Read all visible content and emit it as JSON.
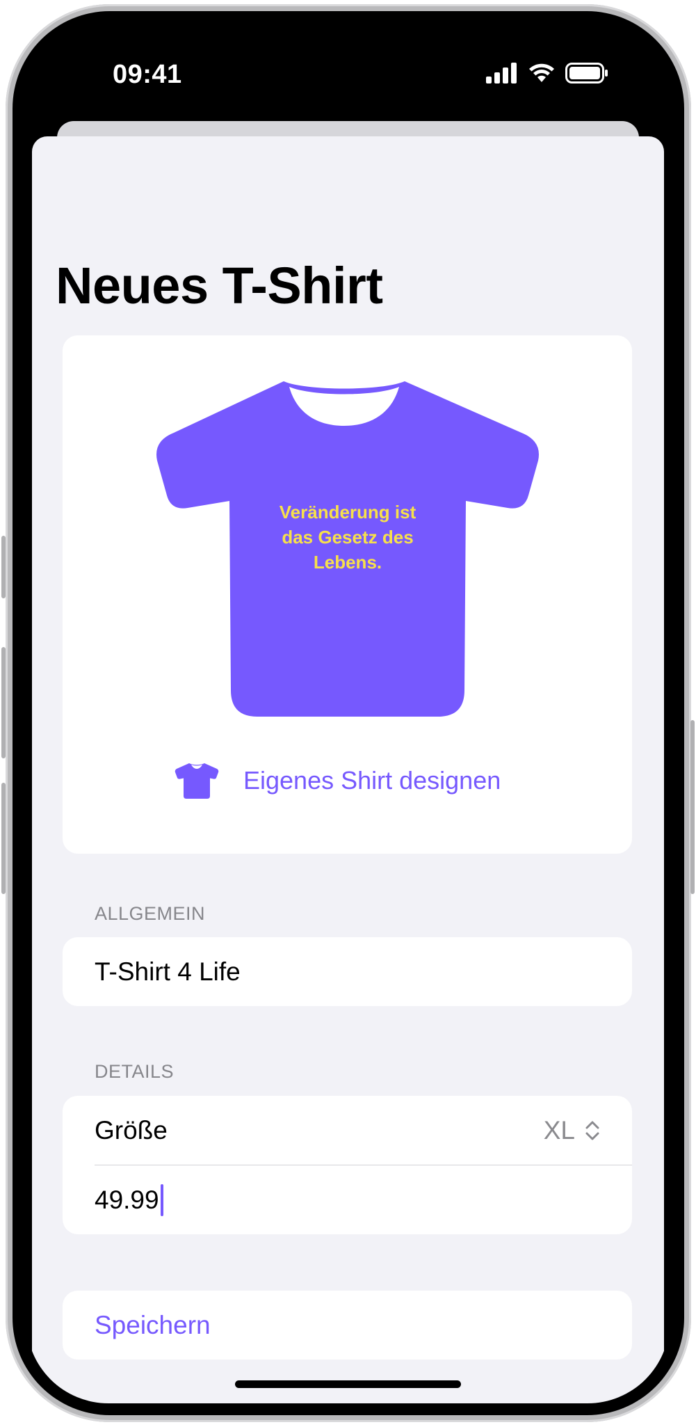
{
  "status_bar": {
    "time": "09:41"
  },
  "sheet": {
    "title": "Neues T-Shirt"
  },
  "shirt_preview": {
    "shirt_color": "#7659FE",
    "text_color": "#F7E04B",
    "shirt_text": "Veränderung ist\ndas Gesetz des\nLebens.",
    "design_button_label": "Eigenes Shirt designen",
    "design_button_icon": "tshirt-icon"
  },
  "sections": {
    "general": {
      "header": "ALLGEMEIN",
      "name_value": "T-Shirt 4 Life"
    },
    "details": {
      "header": "DETAILS",
      "size_label": "Größe",
      "size_value": "XL",
      "price_value": "49.99"
    }
  },
  "actions": {
    "save_label": "Speichern"
  },
  "colors": {
    "accent": "#7659FE",
    "background": "#F2F2F7",
    "card": "#FFFFFF",
    "secondary_text": "#86868B"
  }
}
